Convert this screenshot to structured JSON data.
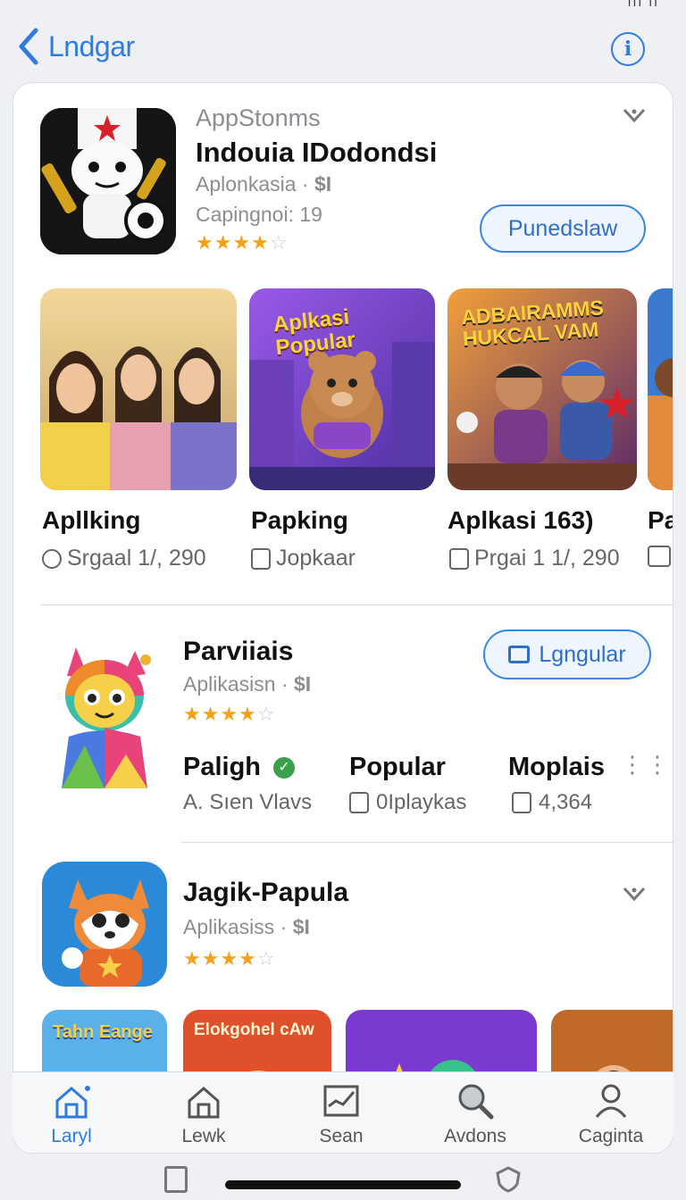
{
  "status": {
    "glyph": "ııı  ıı"
  },
  "nav": {
    "back_label": "Lndgar"
  },
  "featured": {
    "developer": "AppStonms",
    "name": "Indouia IDodondsi",
    "category": "Aplonkasia",
    "price_badge": "$I",
    "rating_count": "Capingnoi: 19",
    "stars": 4,
    "action_label": "Punedslaw"
  },
  "screenshots": [
    {
      "title": "Apllking",
      "subtitle": "Srgaal 1/, 290",
      "icon": "clock-icon"
    },
    {
      "title": "Papking",
      "subtitle": "Jopkaar",
      "icon": "doc-icon",
      "banner": "Aplkasi Popular"
    },
    {
      "title": "Aplkasi 163)",
      "subtitle": "Prgai 1 1/, 290",
      "icon": "doc-icon",
      "banner": "ADBAIRAMMS HUKCAL VAM"
    },
    {
      "title": "Pa",
      "subtitle": "",
      "icon": "image-icon"
    }
  ],
  "second_app": {
    "name": "Parviiais",
    "category": "Aplikasisn",
    "price_badge": "$I",
    "stars": 4,
    "action_label": "Lgngular",
    "stats": [
      {
        "title": "Paligh",
        "subtitle": "A. Sıen Vlavs"
      },
      {
        "title": "Popular",
        "subtitle": "0Iplaykas"
      },
      {
        "title": "Moplais",
        "subtitle": "4,364"
      }
    ]
  },
  "third_app": {
    "name": "Jagik-Papula",
    "category": "Aplikasiss",
    "price_badge": "$I",
    "stars": 4,
    "thumbs": [
      {
        "banner": "Tahn Eange"
      },
      {
        "banner": "Elokgohel cAw"
      },
      {
        "banner": ""
      },
      {
        "banner": ""
      }
    ]
  },
  "tabs": [
    {
      "label": "Laryl",
      "icon": "home-icon",
      "active": true
    },
    {
      "label": "Lewk",
      "icon": "house-outline-icon",
      "active": false
    },
    {
      "label": "Sean",
      "icon": "chart-icon",
      "active": false
    },
    {
      "label": "Avdons",
      "icon": "search-icon",
      "active": false
    },
    {
      "label": "Caginta",
      "icon": "person-icon",
      "active": false
    }
  ],
  "colors": {
    "accent": "#2f7be0",
    "star": "#f3a21b",
    "bg": "#eef0f3"
  }
}
